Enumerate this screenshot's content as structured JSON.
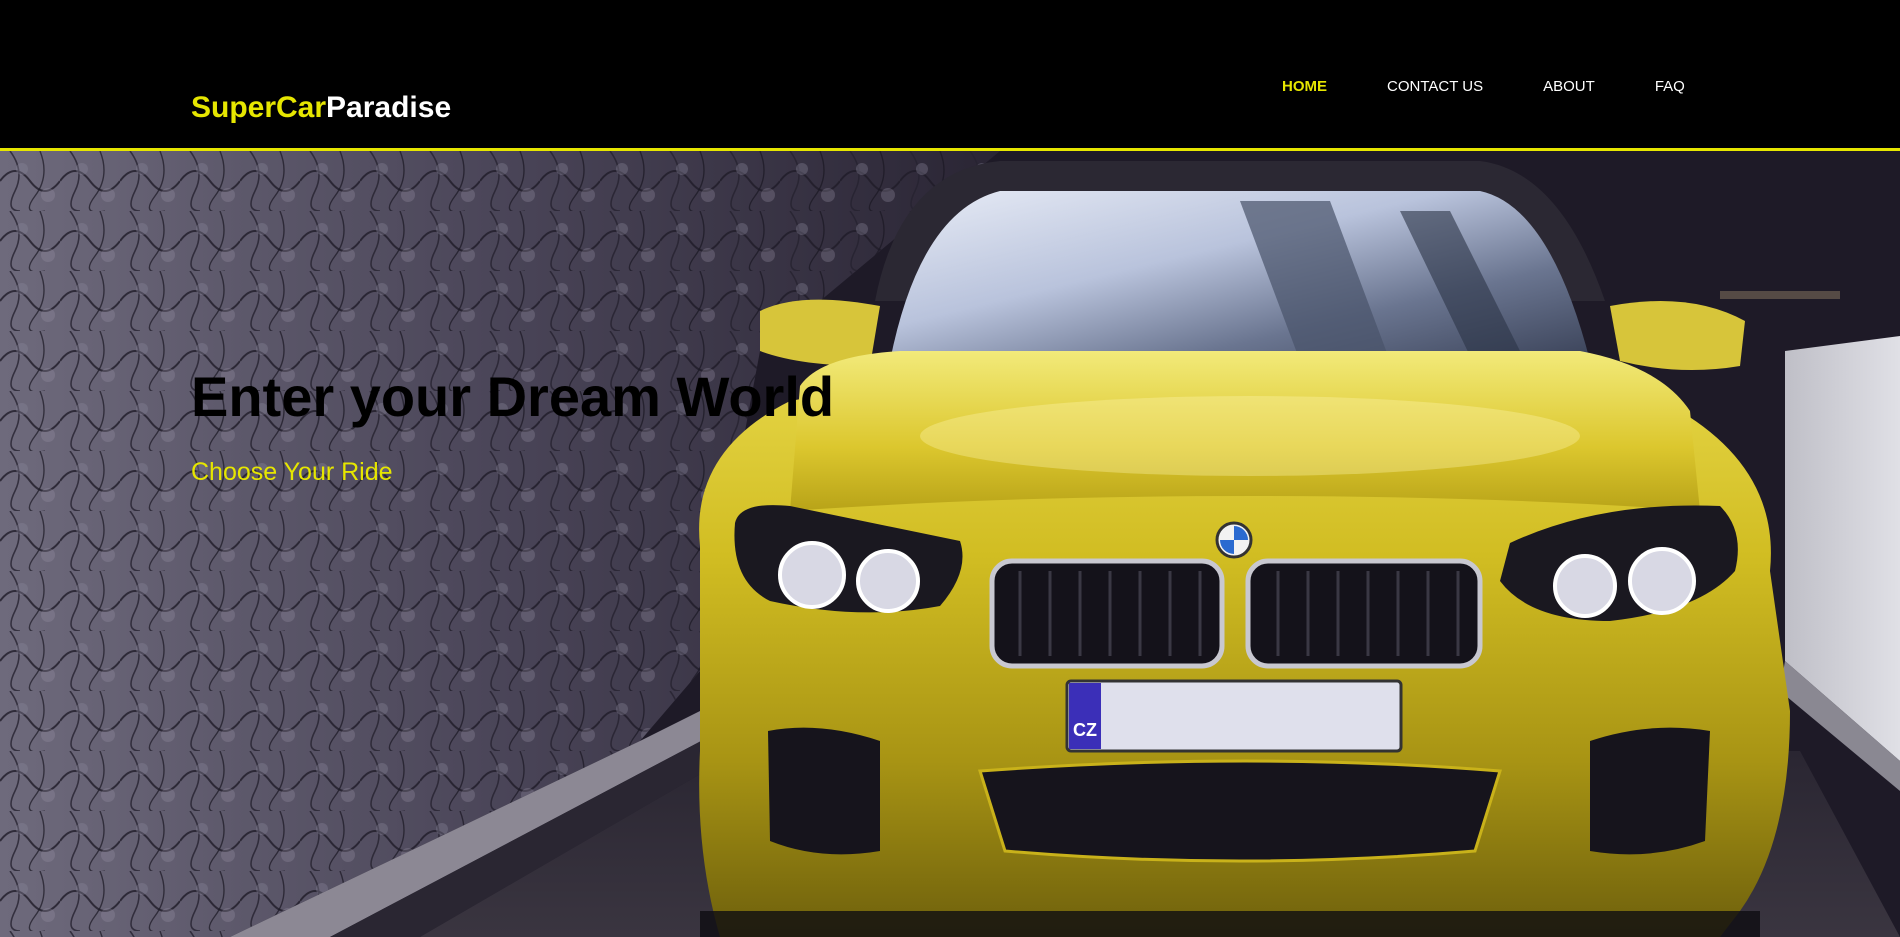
{
  "brand": {
    "part_a": "SuperCar",
    "part_b": "Paradise"
  },
  "nav": {
    "items": [
      {
        "label": "HOME",
        "active": true
      },
      {
        "label": "CONTACT US",
        "active": false
      },
      {
        "label": "ABOUT",
        "active": false
      },
      {
        "label": "FAQ",
        "active": false
      }
    ]
  },
  "hero": {
    "title": "Enter your Dream World",
    "subtitle": "Choose Your Ride",
    "plate_country": "CZ"
  },
  "colors": {
    "accent": "#e6e600",
    "header_bg": "#000000",
    "car_body": "#c9b21a"
  }
}
